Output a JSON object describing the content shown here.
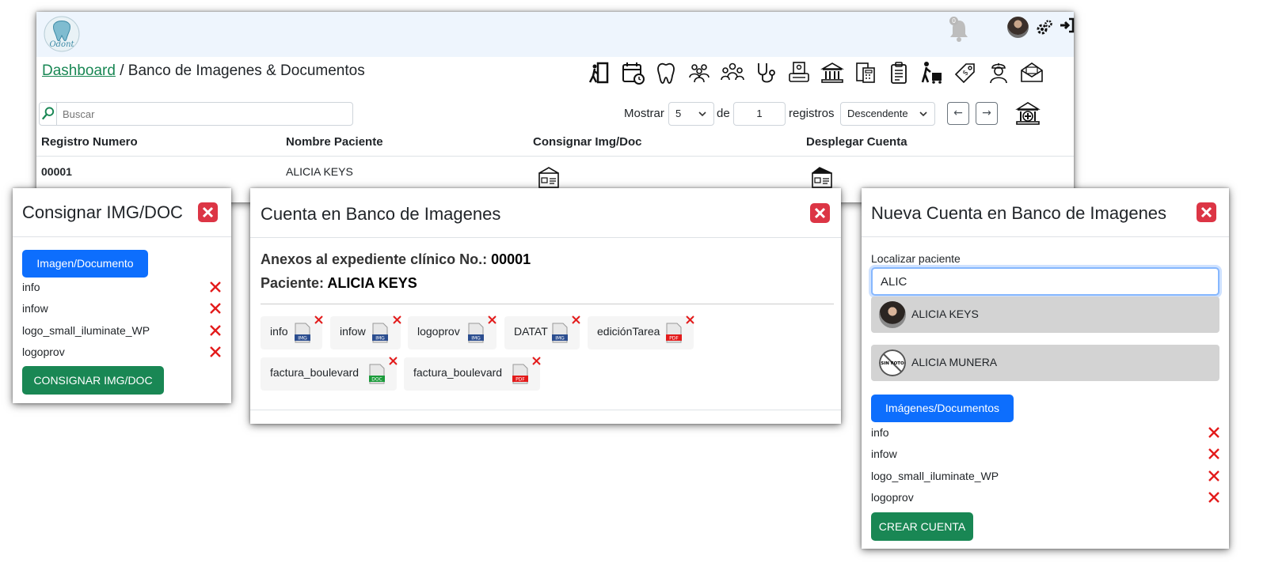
{
  "app": {
    "logo_text": "Odont",
    "notification_count": "0",
    "colors": {
      "topbar": "#eef5fd",
      "primary": "#0d6efd",
      "success": "#198754",
      "danger": "#dc3545"
    }
  },
  "breadcrumb": {
    "link": "Dashboard",
    "separator": " / ",
    "current": "Banco de Imagenes & Documentos"
  },
  "toolbar_icons": [
    "exit-door-icon",
    "calendar-icon",
    "tooth-icon",
    "group-icon",
    "team-icon",
    "stethoscope-icon",
    "printer-icon",
    "bank-icon",
    "calculator-docs-icon",
    "clipboard-icon",
    "cart-person-icon",
    "price-tag-icon",
    "nurse-icon",
    "mail-icon"
  ],
  "search": {
    "placeholder": "Buscar"
  },
  "pagination": {
    "mostrar_label": "Mostrar",
    "page_size": "5",
    "de_label": "de",
    "page": "1",
    "registros_label": "registros",
    "order": "Descendente",
    "prev": "←",
    "next": "→"
  },
  "table": {
    "headers": [
      "Registro Numero",
      "Nombre Paciente",
      "Consignar Img/Doc",
      "Desplegar Cuenta"
    ],
    "rows": [
      {
        "numero": "00001",
        "paciente": "ALICIA KEYS"
      }
    ]
  },
  "modal_consignar": {
    "title": "Consignar IMG/DOC",
    "pick_button": "Imagen/Documento",
    "files": [
      "info",
      "infow",
      "logo_small_iluminate_WP",
      "logoprov"
    ],
    "submit": "CONSIGNAR IMG/DOC"
  },
  "modal_cuenta": {
    "title": "Cuenta en Banco de Imagenes",
    "anexos_label": "Anexos al expediente clínico No.: ",
    "anexos_value": "00001",
    "paciente_label": "Paciente: ",
    "paciente_value": "ALICIA KEYS",
    "chips": [
      {
        "name": "info",
        "type": "IMG"
      },
      {
        "name": "infow",
        "type": "IMG"
      },
      {
        "name": "logoprov",
        "type": "IMG"
      },
      {
        "name": "DATAT",
        "type": "IMG"
      },
      {
        "name": "ediciónTarea",
        "type": "PDF"
      },
      {
        "name": "factura_boulevard",
        "type": "DOC"
      },
      {
        "name": "factura_boulevard",
        "type": "PDF"
      }
    ]
  },
  "modal_nueva": {
    "title": "Nueva Cuenta en Banco de Imagenes",
    "locate_label": "Localizar paciente",
    "search_value": "ALIC",
    "results": [
      {
        "name": "ALICIA KEYS",
        "avatar": "photo"
      },
      {
        "name": "ALICIA MUNERA",
        "avatar": "SIN FOTO"
      }
    ],
    "pick_button": "Imágenes/Documentos",
    "files": [
      "info",
      "infow",
      "logo_small_iluminate_WP",
      "logoprov"
    ],
    "submit": "CREAR CUENTA"
  }
}
